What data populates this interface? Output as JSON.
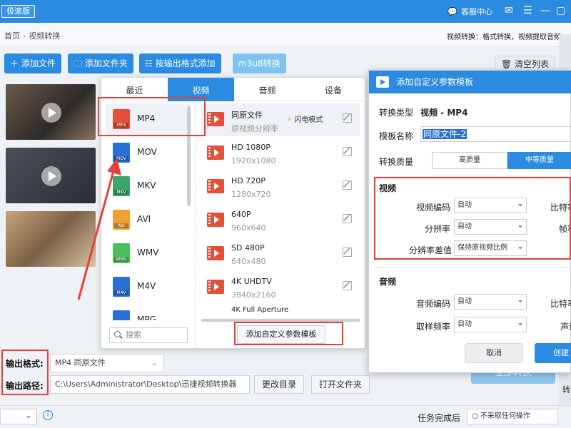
{
  "app": {
    "badge": "极速版",
    "service": "客服中心"
  },
  "breadcrumb": {
    "home": "首页",
    "current": "视频转换"
  },
  "right_note": "视频转换：格式转换，视频提取音频",
  "toolbar": {
    "add_file": "添加文件",
    "add_folder": "添加文件夹",
    "add_by_format": "按输出格式添加",
    "m3u8": "m3u8转换",
    "clear": "清空列表"
  },
  "format_popup": {
    "tabs": [
      "最近",
      "视频",
      "音频",
      "设备"
    ],
    "active_tab": "视频",
    "formats": [
      {
        "name": "MP4",
        "color": "#e4503a"
      },
      {
        "name": "MOV",
        "color": "#2a6fd6"
      },
      {
        "name": "MKV",
        "color": "#3aa66b"
      },
      {
        "name": "AVI",
        "color": "#f0a030"
      },
      {
        "name": "WMV",
        "color": "#4cbf5a"
      },
      {
        "name": "M4V",
        "color": "#2a6fd6"
      },
      {
        "name": "MPG",
        "color": "#2a6fd6"
      }
    ],
    "presets": [
      {
        "name": "同原文件",
        "sub": "原视频分辨率",
        "tag": "闪电模式"
      },
      {
        "name": "HD 1080P",
        "sub": "1920x1080"
      },
      {
        "name": "HD 720P",
        "sub": "1280x720"
      },
      {
        "name": "640P",
        "sub": "960x640"
      },
      {
        "name": "SD 480P",
        "sub": "640x480"
      },
      {
        "name": "4K UHDTV",
        "sub": "3840x2160"
      },
      {
        "name": "4K Full Aperture",
        "sub": ""
      }
    ],
    "search_placeholder": "搜索",
    "add_template": "添加自定义参数模板"
  },
  "dialog": {
    "title": "添加自定义参数模板",
    "convert_type_label": "转换类型",
    "convert_type": "视频 - MP4",
    "template_name_label": "模板名称",
    "template_name": "同原文件-2",
    "quality_label": "转换质量",
    "quality_options": [
      "高质量",
      "中等质量"
    ],
    "video_section": "视频",
    "video_codec_label": "视频编码",
    "video_codec": "自动",
    "resolution_label": "分辨率",
    "resolution": "自动",
    "interp_label": "分辨率差值",
    "interp": "保持原视频比例",
    "bitrate_label": "比特率",
    "framerate_label": "帧率",
    "audio_section": "音频",
    "audio_codec_label": "音频编码",
    "audio_codec": "自动",
    "sample_label": "取样频率",
    "sample": "自动",
    "audio_bitrate_label": "比特率",
    "channel_label": "声道",
    "cancel": "取消",
    "create": "创建"
  },
  "output": {
    "format_label": "输出格式:",
    "format_value": "MP4  同原文件",
    "path_label": "输出路径:",
    "path_value": "C:\\Users\\Administrator\\Desktop\\迅捷视频转换器",
    "change_dir": "更改目录",
    "open_folder": "打开文件夹",
    "start": "全部转换"
  },
  "status": {
    "on_complete_label": "任务完成后",
    "on_complete_value": "不采取任何操作",
    "side_text": "转"
  }
}
